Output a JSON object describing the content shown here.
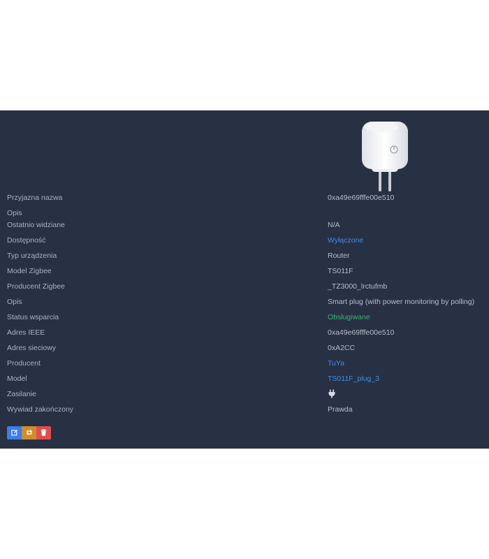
{
  "colors": {
    "panel_bg": "#283044",
    "label": "#a9b2c3",
    "value": "#b6bdcb",
    "link": "#3f8fe6",
    "supported": "#37b36a",
    "edit_button": "#3a7ee6",
    "interview_button": "#cf8d2b",
    "remove_button": "#e04d4d"
  },
  "device": {
    "image_icon": "smart-plug-image",
    "rows": [
      {
        "label": "Przyjazna nazwa",
        "value": "0xa49e69fffe00e510"
      },
      {
        "label": "Opis",
        "value": ""
      },
      {
        "label": "Ostatnio widziane",
        "value": "N/A"
      },
      {
        "label": "Dostępność",
        "value": "Wyłączone"
      },
      {
        "label": "Typ urządzenia",
        "value": "Router"
      },
      {
        "label": "Model Zigbee",
        "value": "TS011F"
      },
      {
        "label": "Producent Zigbee",
        "value": "_TZ3000_lrctufmb"
      },
      {
        "label": "Opis",
        "value": "Smart plug (with power monitoring by polling)"
      },
      {
        "label": "Status wsparcia",
        "value": "Obsługiwane"
      },
      {
        "label": "Adres IEEE",
        "value": "0xa49e69fffe00e510"
      },
      {
        "label": "Adres sieciowy",
        "value": "0xA2CC"
      },
      {
        "label": "Producent",
        "value": "TuYa"
      },
      {
        "label": "Model",
        "value": "TS011F_plug_3"
      },
      {
        "label": "Zasilanie",
        "value_icon": "plug-power-icon"
      },
      {
        "label": "Wywiad zakończony",
        "value": "Prawda"
      }
    ]
  },
  "actions": {
    "edit_icon": "edit-icon",
    "interview_icon": "reconfigure-icon",
    "remove_icon": "trash-icon"
  }
}
